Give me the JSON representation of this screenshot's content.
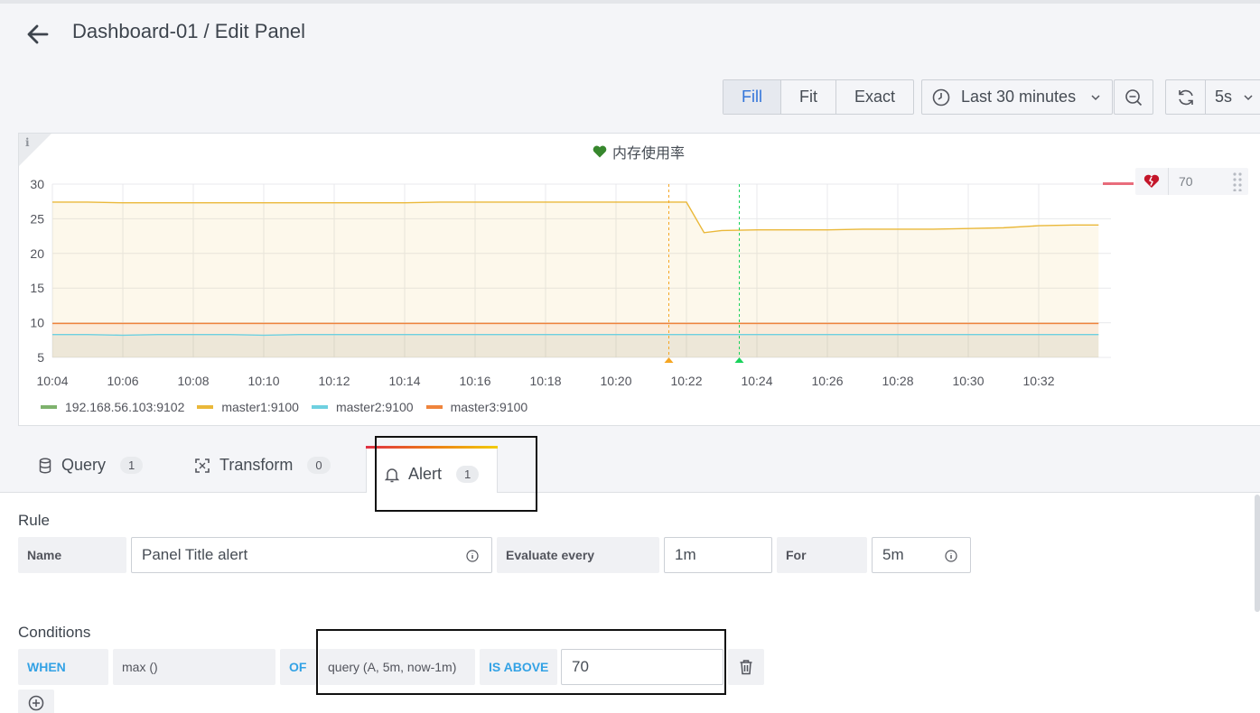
{
  "header": {
    "breadcrumb": "Dashboard-01 / Edit Panel"
  },
  "toolbar": {
    "fill_label": "Fill",
    "fit_label": "Fit",
    "exact_label": "Exact",
    "time_range": "Last 30 minutes",
    "refresh_interval": "5s"
  },
  "panel": {
    "title": "内存使用率",
    "threshold_value": "70",
    "chart_data": {
      "type": "area",
      "ylim": [
        5,
        30
      ],
      "y_ticks": [
        "30",
        "25",
        "20",
        "15",
        "10",
        "5"
      ],
      "x_ticks": [
        "10:04",
        "10:06",
        "10:08",
        "10:10",
        "10:12",
        "10:14",
        "10:16",
        "10:18",
        "10:20",
        "10:22",
        "10:24",
        "10:26",
        "10:28",
        "10:30",
        "10:32"
      ],
      "x_minutes": [
        4,
        5,
        6,
        7,
        8,
        9,
        10,
        11,
        12,
        13,
        14,
        15,
        16,
        17,
        18,
        19,
        20,
        21,
        22,
        22.5,
        23,
        24,
        25,
        26,
        27,
        28,
        29,
        30,
        31,
        32,
        33,
        33.7
      ],
      "series": [
        {
          "name": "192.168.56.103:9102",
          "color": "#7eb26d",
          "values": []
        },
        {
          "name": "master1:9100",
          "color": "#eab839",
          "values": [
            27.4,
            27.4,
            27.3,
            27.3,
            27.3,
            27.3,
            27.3,
            27.3,
            27.3,
            27.3,
            27.3,
            27.4,
            27.4,
            27.4,
            27.4,
            27.4,
            27.4,
            27.4,
            27.4,
            23.0,
            23.3,
            23.4,
            23.4,
            23.4,
            23.5,
            23.5,
            23.5,
            23.6,
            23.7,
            24.0,
            24.1,
            24.1
          ]
        },
        {
          "name": "master2:9100",
          "color": "#6ed0e0",
          "values": [
            8.3,
            8.3,
            8.2,
            8.3,
            8.3,
            8.3,
            8.2,
            8.3,
            8.3,
            8.3,
            8.3,
            8.3,
            8.3,
            8.3,
            8.3,
            8.3,
            8.3,
            8.3,
            8.3,
            8.3,
            8.3,
            8.3,
            8.3,
            8.3,
            8.3,
            8.3,
            8.3,
            8.3,
            8.3,
            8.3,
            8.3,
            8.3
          ]
        },
        {
          "name": "master3:9100",
          "color": "#ef843c",
          "values": [
            9.9,
            9.9,
            9.9,
            9.9,
            9.9,
            9.9,
            9.9,
            9.9,
            9.9,
            9.9,
            9.9,
            9.9,
            9.9,
            9.9,
            9.9,
            9.9,
            9.9,
            9.9,
            9.9,
            9.9,
            9.9,
            9.9,
            9.9,
            9.9,
            9.9,
            9.9,
            9.9,
            9.9,
            9.9,
            9.9,
            9.9,
            9.9
          ]
        }
      ],
      "annotations": [
        {
          "minute": 21.5,
          "color": "#f5a623"
        },
        {
          "minute": 23.5,
          "color": "#19d25b"
        }
      ]
    }
  },
  "tabs": [
    {
      "label": "Query",
      "count": "1"
    },
    {
      "label": "Transform",
      "count": "0"
    },
    {
      "label": "Alert",
      "count": "1"
    }
  ],
  "rule": {
    "heading": "Rule",
    "name_label": "Name",
    "name_value": "Panel Title alert",
    "evaluate_label": "Evaluate every",
    "evaluate_value": "1m",
    "for_label": "For",
    "for_value": "5m"
  },
  "conditions": {
    "heading": "Conditions",
    "when": "WHEN",
    "func": "max ()",
    "of": "OF",
    "query": "query (A, 5m, now-1m)",
    "is_above": "IS ABOVE",
    "threshold": "70"
  }
}
